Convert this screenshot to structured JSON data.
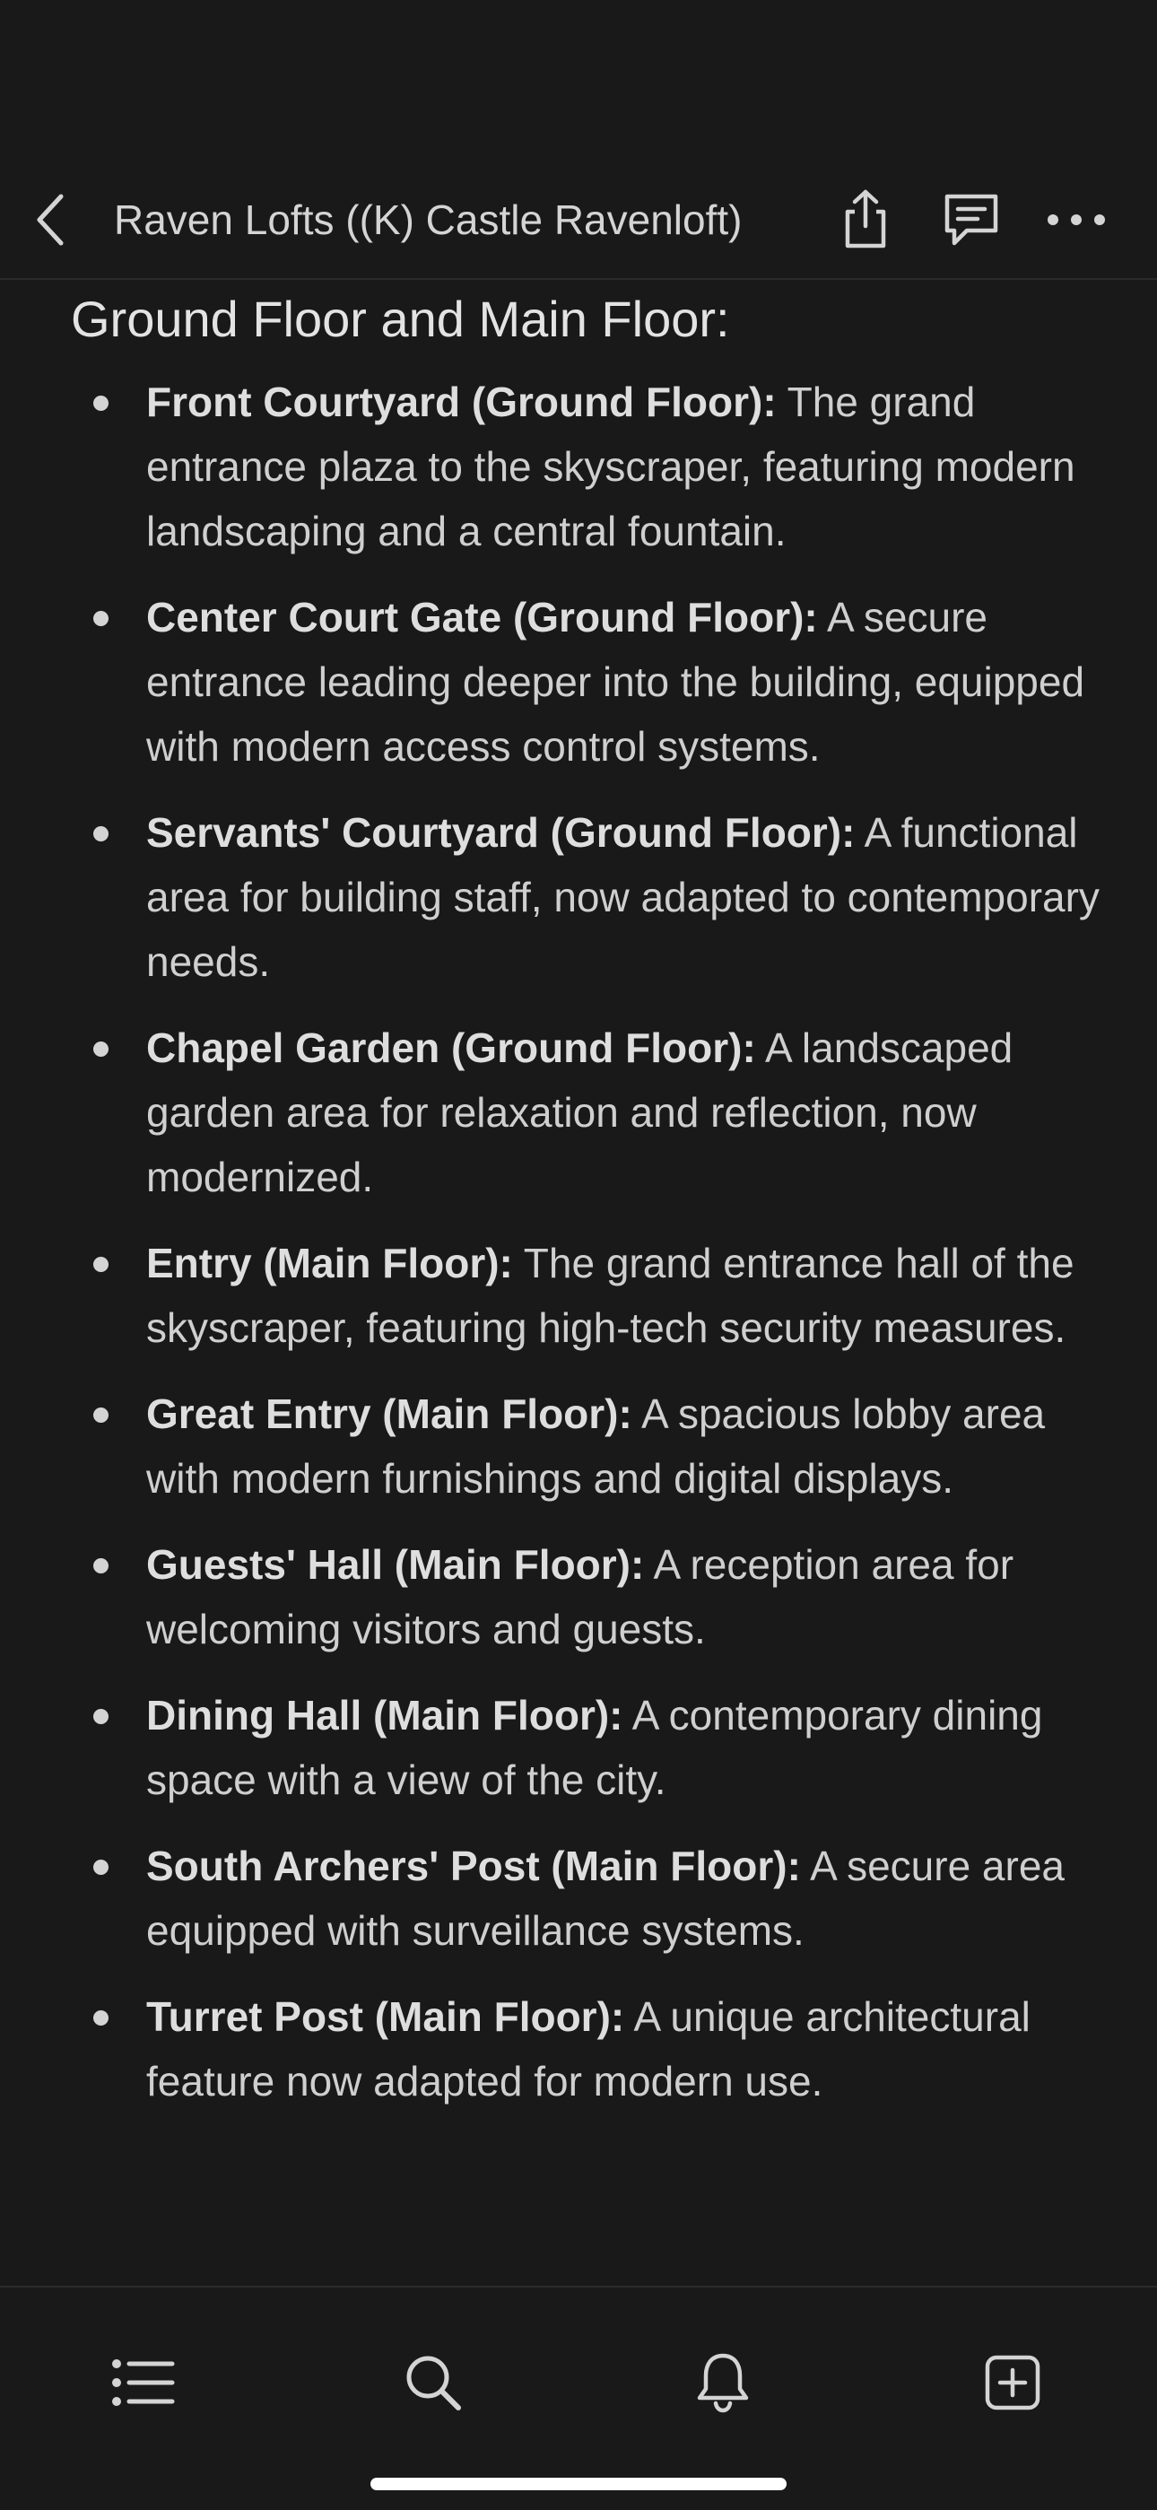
{
  "header": {
    "title": "Raven Lofts ((K) Castle Ravenloft)",
    "back_icon": "chevron-left-icon",
    "share_icon": "share-icon",
    "comments_icon": "comment-icon",
    "more_icon": "more-horizontal-icon"
  },
  "main": {
    "heading": "Ground Floor and Main Floor:",
    "items": [
      {
        "name": "Front Courtyard (Ground Floor):",
        "description": " The grand entrance plaza to the skyscraper, featuring modern landscaping and a central fountain."
      },
      {
        "name": "Center Court Gate (Ground Floor):",
        "description": " A secure entrance leading deeper into the building, equipped with modern access control systems."
      },
      {
        "name": "Servants' Courtyard (Ground Floor):",
        "description": " A functional area for building staff, now adapted to contemporary needs."
      },
      {
        "name": "Chapel Garden (Ground Floor):",
        "description": " A landscaped garden area for relaxation and reflection, now modernized."
      },
      {
        "name": "Entry (Main Floor):",
        "description": " The grand entrance hall of the skyscraper, featuring high-tech security measures."
      },
      {
        "name": "Great Entry (Main Floor):",
        "description": " A spacious lobby area with modern furnishings and digital displays."
      },
      {
        "name": "Guests' Hall (Main Floor):",
        "description": " A reception area for welcoming visitors and guests."
      },
      {
        "name": "Dining Hall (Main Floor):",
        "description": " A contemporary dining space with a view of the city."
      },
      {
        "name": "South Archers' Post (Main Floor):",
        "description": " A secure area equipped with surveillance systems."
      },
      {
        "name": "Turret Post (Main Floor):",
        "description": " A unique architectural feature now adapted for modern use."
      }
    ]
  },
  "bottom_bar": {
    "tabs": [
      {
        "icon": "list-icon"
      },
      {
        "icon": "search-icon"
      },
      {
        "icon": "bell-icon"
      },
      {
        "icon": "new-page-icon"
      }
    ]
  },
  "colors": {
    "background": "#191919",
    "text": "#d4d4d4",
    "divider": "#2a2a2a"
  }
}
